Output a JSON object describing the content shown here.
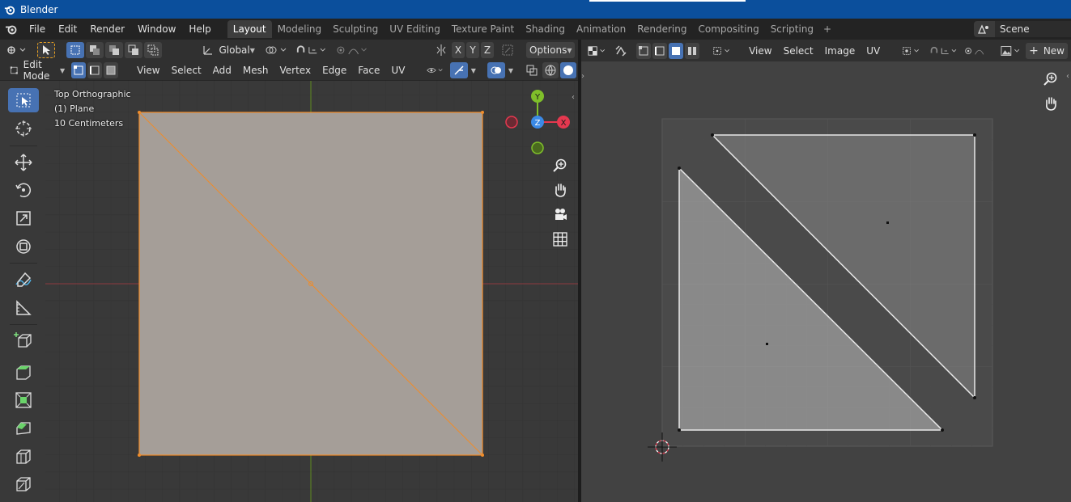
{
  "window": {
    "title": "Blender"
  },
  "menu": [
    "File",
    "Edit",
    "Render",
    "Window",
    "Help"
  ],
  "workspaces": [
    "Layout",
    "Modeling",
    "Sculpting",
    "UV Editing",
    "Texture Paint",
    "Shading",
    "Animation",
    "Rendering",
    "Compositing",
    "Scripting"
  ],
  "active_workspace": "Layout",
  "scene": {
    "name": "Scene"
  },
  "viewport": {
    "transform_orientation": "Global",
    "options_label": "Options",
    "axis_labels": [
      "X",
      "Y",
      "Z"
    ],
    "mode": "Edit Mode",
    "menus": [
      "View",
      "Select",
      "Add",
      "Mesh",
      "Vertex",
      "Edge",
      "Face",
      "UV"
    ],
    "overlay": {
      "view_name": "Top Orthographic",
      "object": "(1) Plane",
      "scale": "10 Centimeters"
    },
    "gizmo": {
      "x": "X",
      "y": "Y",
      "z": "Z"
    }
  },
  "uv_editor": {
    "menus": [
      "View",
      "Select",
      "Image",
      "UV"
    ],
    "new_label": "New"
  },
  "colors": {
    "title_bar": "#0b4f9c",
    "accent_blue": "#4772b3",
    "mesh_face": "#a59e98",
    "mesh_edge": "#f08c2a",
    "x_axis": "#e5384f",
    "y_axis": "#7fbf2a",
    "z_axis": "#3b8ae6"
  }
}
